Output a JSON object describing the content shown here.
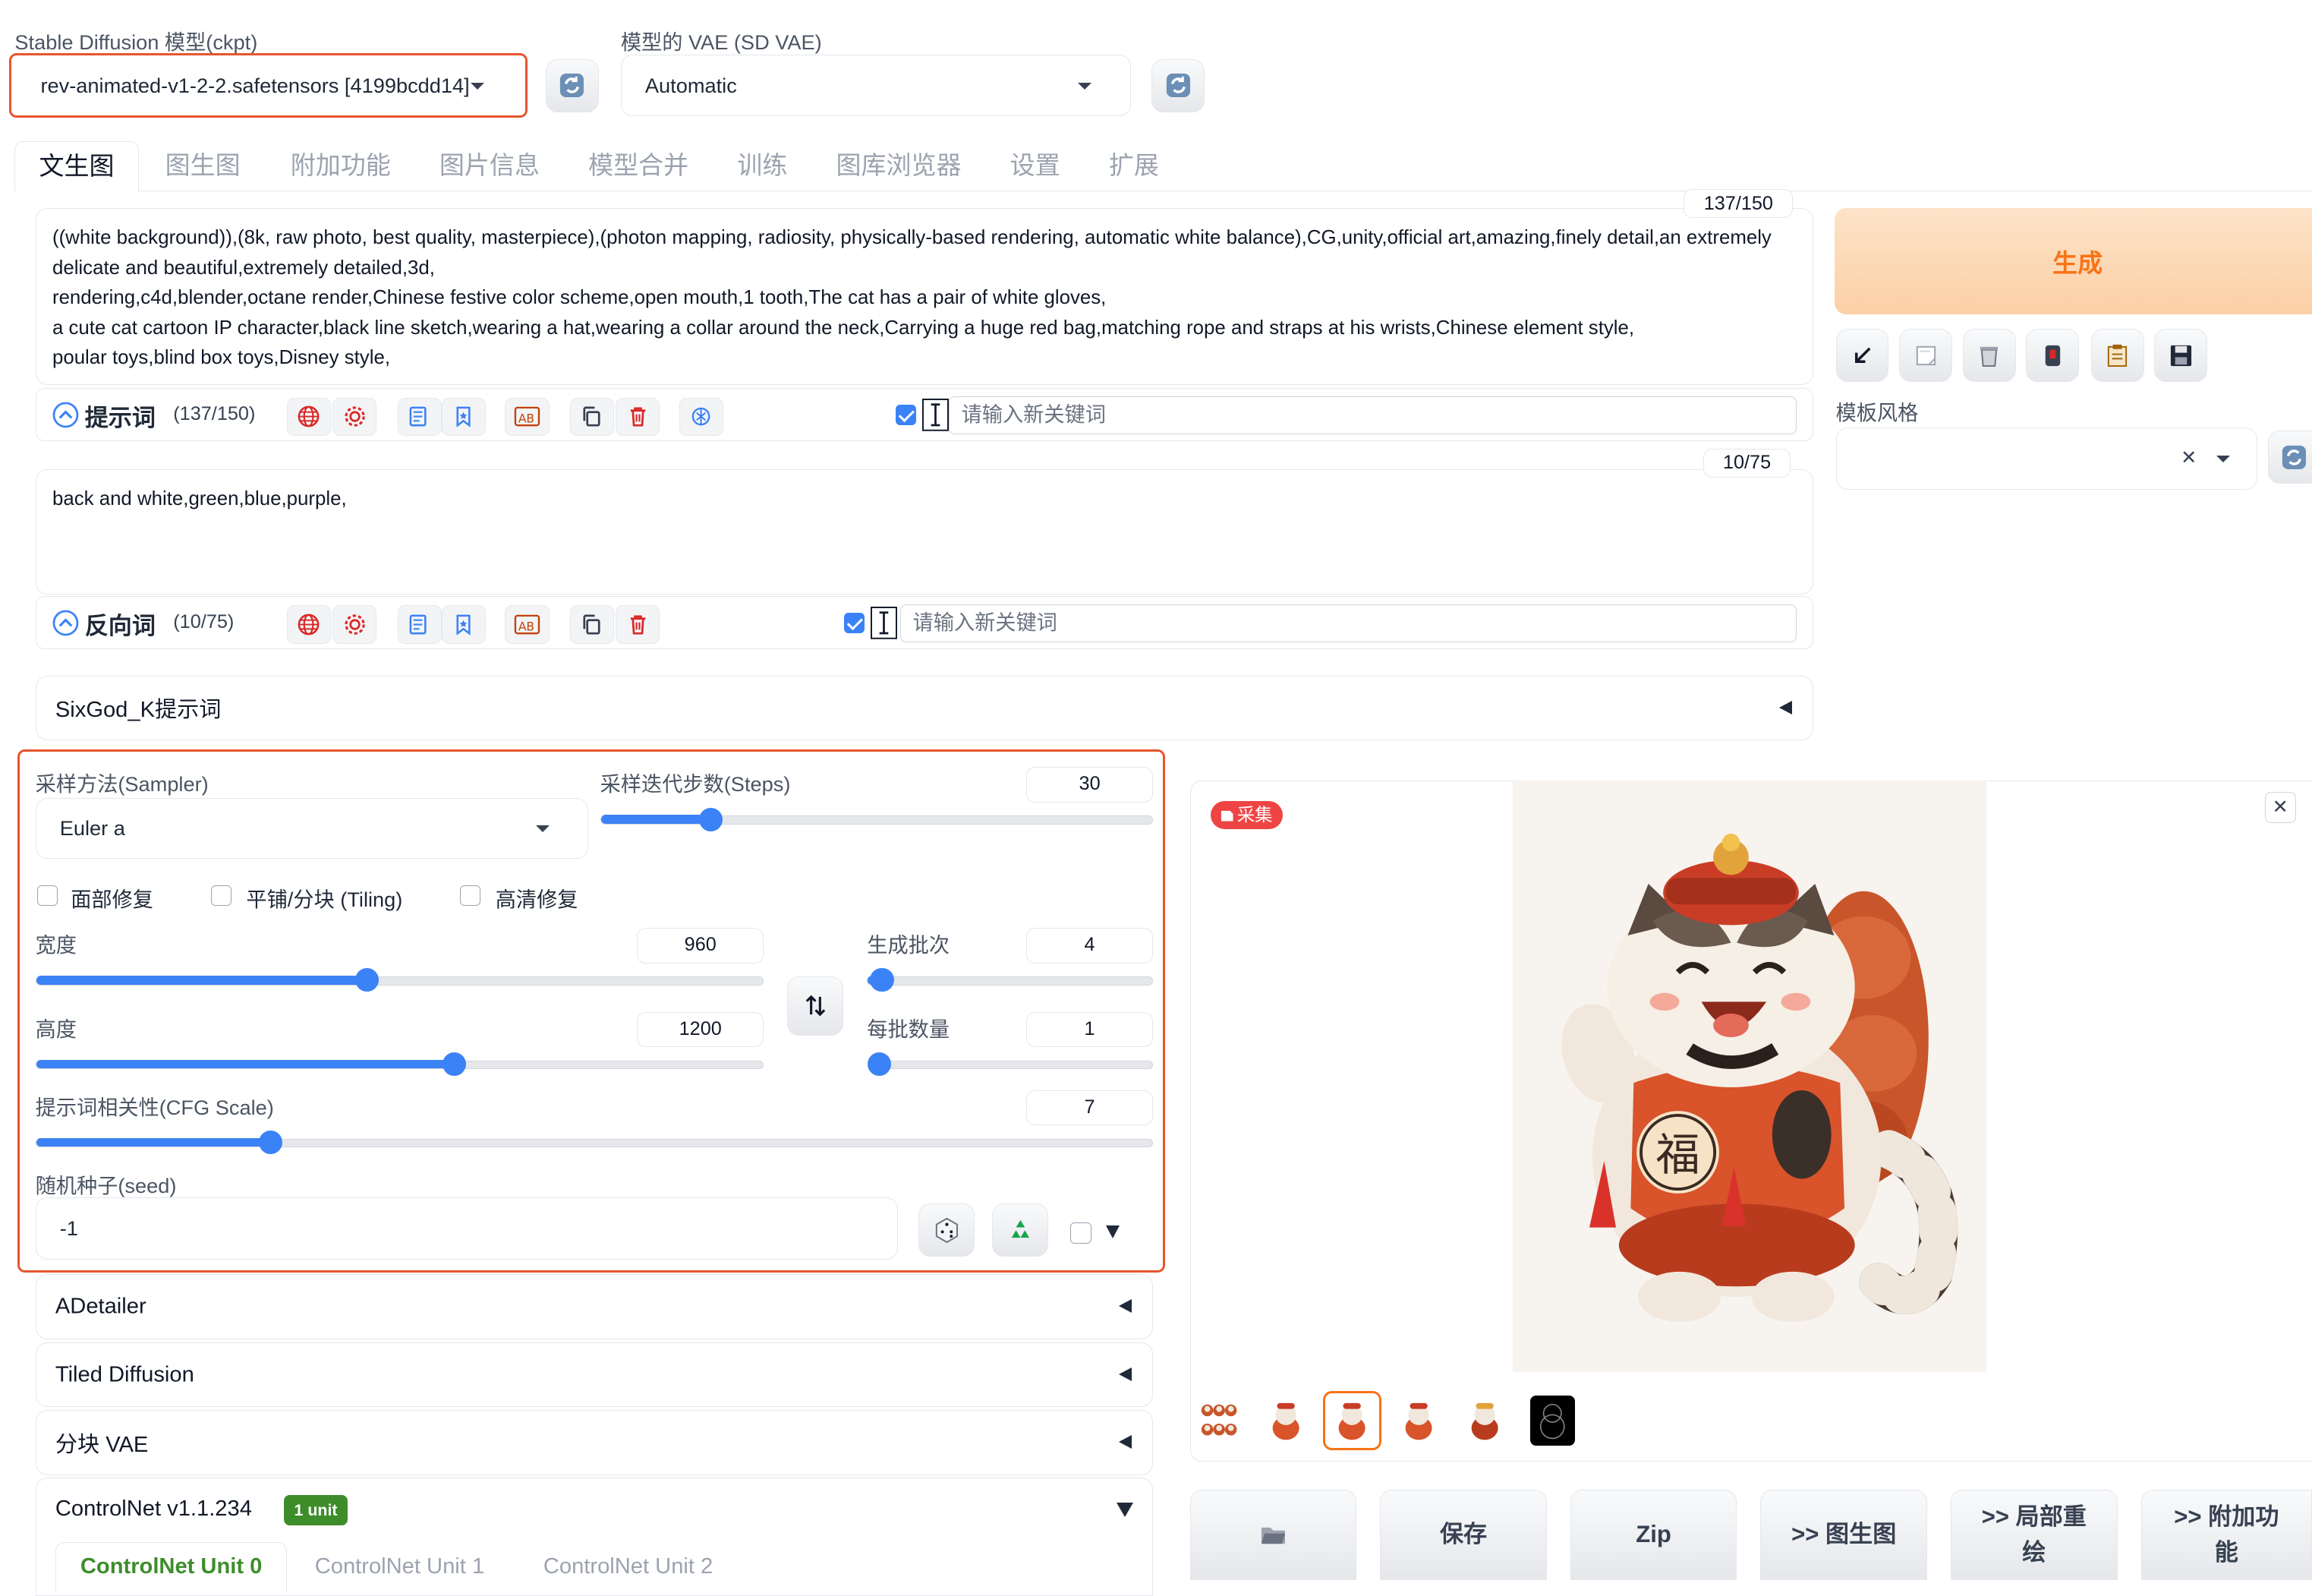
{
  "model": {
    "label": "Stable Diffusion 模型(ckpt)",
    "value": "rev-animated-v1-2-2.safetensors [4199bcdd14]"
  },
  "vae": {
    "label": "模型的 VAE (SD VAE)",
    "value": "Automatic"
  },
  "tabs": [
    "文生图",
    "图生图",
    "附加功能",
    "图片信息",
    "模型合并",
    "训练",
    "图库浏览器",
    "设置",
    "扩展"
  ],
  "prompt": {
    "text": "((white background)),(8k, raw photo, best quality, masterpiece),(photon mapping, radiosity, physically-based rendering, automatic white balance),CG,unity,official art,amazing,finely detail,an extremely delicate and beautiful,extremely detailed,3d,\nrendering,c4d,blender,octane render,Chinese festive color scheme,open mouth,1 tooth,The cat has a pair of white gloves,\na cute cat cartoon IP character,black line sketch,wearing a hat,wearing a collar around the neck,Carrying a huge red bag,matching rope and straps at his wrists,Chinese element style,\npoular toys,blind box toys,Disney style,",
    "counter": "137/150",
    "section_label": "提示词",
    "section_count": "(137/150)",
    "keyword_placeholder": "请输入新关键词"
  },
  "negative": {
    "text": "back and white,green,blue,purple,",
    "counter": "10/75",
    "section_label": "反向词",
    "section_count": "(10/75)",
    "keyword_placeholder": "请输入新关键词"
  },
  "generate_label": "生成",
  "template_style_label": "模板风格",
  "sixgod_label": "SixGod_K提示词",
  "sampler": {
    "label": "采样方法(Sampler)",
    "value": "Euler a"
  },
  "steps": {
    "label": "采样迭代步数(Steps)",
    "value": "30",
    "fraction": 0.2
  },
  "checkboxes": {
    "face": "面部修复",
    "tiling": "平铺/分块 (Tiling)",
    "hires": "高清修复"
  },
  "width": {
    "label": "宽度",
    "value": "960",
    "fraction": 0.455
  },
  "height": {
    "label": "高度",
    "value": "1200",
    "fraction": 0.575
  },
  "batch_count": {
    "label": "生成批次",
    "value": "4",
    "fraction": 0.05
  },
  "batch_size": {
    "label": "每批数量",
    "value": "1",
    "fraction": 0.0
  },
  "cfg": {
    "label": "提示词相关性(CFG Scale)",
    "value": "7",
    "fraction": 0.21
  },
  "seed": {
    "label": "随机种子(seed)",
    "value": "-1"
  },
  "accordions": {
    "adetailer": "ADetailer",
    "tiled_diffusion": "Tiled Diffusion",
    "tiled_vae": "分块 VAE",
    "controlnet": "ControlNet v1.1.234",
    "controlnet_badge": "1 unit"
  },
  "controlnet_tabs": [
    "ControlNet Unit 0",
    "ControlNet Unit 1",
    "ControlNet Unit 2"
  ],
  "collect_badge": "采集",
  "image_char": "福",
  "actions": [
    "保存",
    "Zip",
    ">> 图生图",
    ">> 局部重绘",
    ">> 附加功能"
  ],
  "colors": {
    "accent": "#3b82f6",
    "highlight_border": "#e8552f",
    "generate_text": "#f97316",
    "badge_green": "#3e8d2b"
  }
}
